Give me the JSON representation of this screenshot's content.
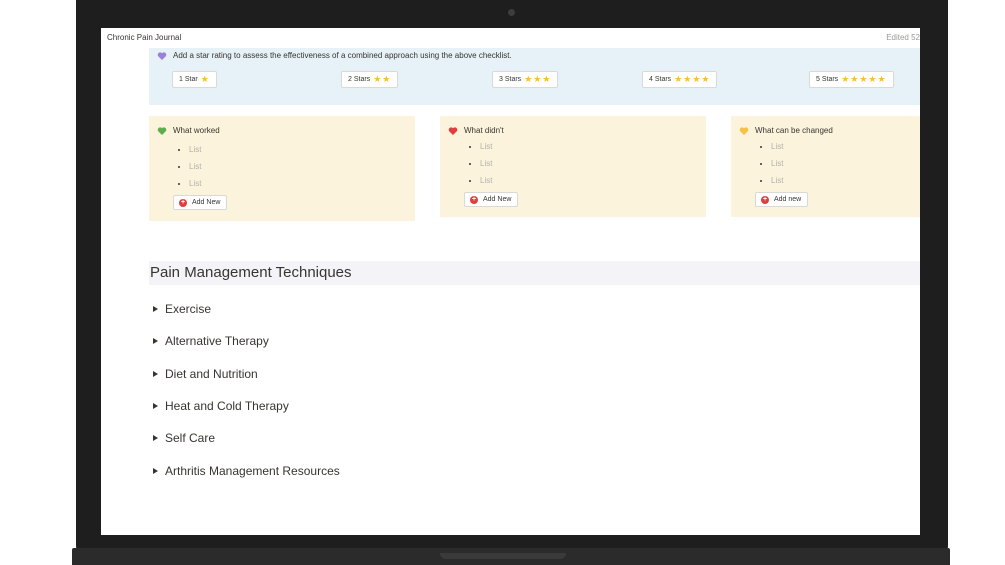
{
  "window": {
    "title": "Chronic Pain Journal",
    "edited": "Edited 52"
  },
  "rating": {
    "instruction": "Add a star rating to assess the effectiveness of a combined approach using the above checklist.",
    "heart_color": "#9b7fd9",
    "options": [
      {
        "label": "1 Star",
        "stars": "★"
      },
      {
        "label": "2 Stars",
        "stars": "★★"
      },
      {
        "label": "3 Stars",
        "stars": "★★★"
      },
      {
        "label": "4 Stars",
        "stars": "★★★★"
      },
      {
        "label": "5 Stars",
        "stars": "★★★★★"
      }
    ]
  },
  "cards": [
    {
      "title": "What worked",
      "heart_color": "#5fae4e",
      "items": [
        "List",
        "List",
        "List"
      ],
      "button": "Add New"
    },
    {
      "title": "What didn't",
      "heart_color": "#e03e3e",
      "items": [
        "List",
        "List",
        "List"
      ],
      "button": "Add New"
    },
    {
      "title": "What can be changed",
      "heart_color": "#f5c242",
      "items": [
        "List",
        "List",
        "List"
      ],
      "button": "Add new"
    }
  ],
  "section": {
    "heading": "Pain Management Techniques",
    "toggles": [
      "Exercise",
      "Alternative Therapy",
      "Diet and Nutrition",
      "Heat and Cold Therapy",
      "Self Care",
      "Arthritis Management Resources"
    ]
  },
  "colors": {
    "callout_blue": "#e7f1f8",
    "callout_yellow": "#fbf3db",
    "star": "#f6c12c"
  }
}
